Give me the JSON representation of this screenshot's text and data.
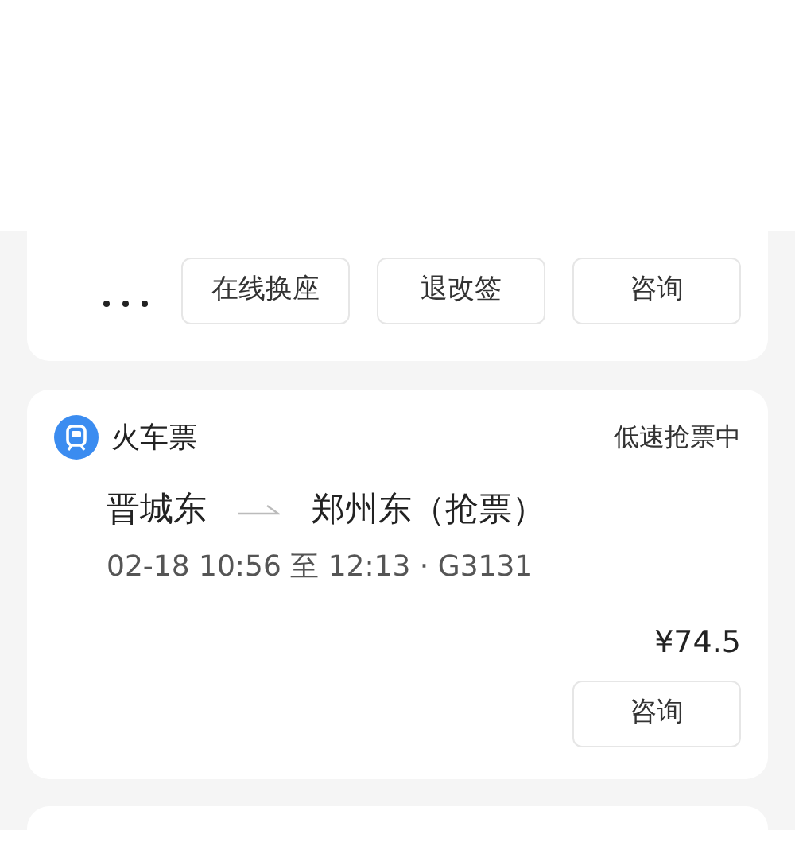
{
  "orders": [
    {
      "actions": [
        "在线换座",
        "退改签",
        "咨询"
      ]
    },
    {
      "type": "火车票",
      "status": "低速抢票中",
      "from": "晋城东",
      "to": "郑州东（抢票）",
      "detail": "02-18 10:56 至 12:13 · G3131",
      "price": "¥74.5",
      "actions": [
        "咨询"
      ]
    }
  ]
}
